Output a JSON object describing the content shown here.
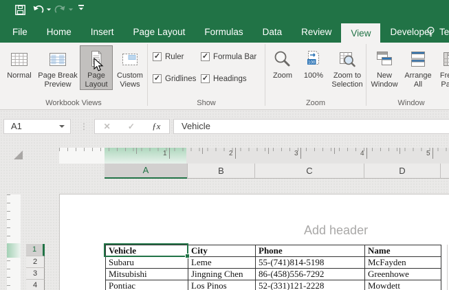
{
  "colors": {
    "brand_green": "#217346",
    "ribbon_bg": "#f3f2f1",
    "canvas_bg": "#e9e8e7",
    "selection_green": "#217346",
    "page_bg": "#ffffff",
    "header_placeholder_gray": "#a9a8a7"
  },
  "titlebar": {
    "qat_icons": [
      "save-icon",
      "undo-icon",
      "redo-icon",
      "customize-qat-icon"
    ]
  },
  "tabs": {
    "items": [
      {
        "label": "File",
        "active": false
      },
      {
        "label": "Home",
        "active": false
      },
      {
        "label": "Insert",
        "active": false
      },
      {
        "label": "Page Layout",
        "active": false
      },
      {
        "label": "Formulas",
        "active": false
      },
      {
        "label": "Data",
        "active": false
      },
      {
        "label": "Review",
        "active": false
      },
      {
        "label": "View",
        "active": true
      },
      {
        "label": "Developer",
        "active": false
      }
    ],
    "tell_me": {
      "icon": "lightbulb-icon",
      "label": "Tell me"
    }
  },
  "ribbon": {
    "groups": [
      {
        "name": "Workbook Views",
        "buttons": [
          {
            "label": "Normal",
            "icon": "normal-view-icon",
            "pressed": false
          },
          {
            "label": "Page Break Preview",
            "icon": "page-break-preview-icon",
            "pressed": false
          },
          {
            "label": "Page Layout",
            "icon": "page-layout-view-icon",
            "pressed": true
          },
          {
            "label": "Custom Views",
            "icon": "custom-views-icon",
            "pressed": false
          }
        ]
      },
      {
        "name": "Show",
        "checkboxes": [
          {
            "label": "Ruler",
            "checked": true
          },
          {
            "label": "Gridlines",
            "checked": true
          },
          {
            "label": "Formula Bar",
            "checked": true
          },
          {
            "label": "Headings",
            "checked": true
          }
        ]
      },
      {
        "name": "Zoom",
        "buttons": [
          {
            "label": "Zoom",
            "icon": "zoom-icon"
          },
          {
            "label": "100%",
            "icon": "zoom-100-icon"
          },
          {
            "label": "Zoom to Selection",
            "icon": "zoom-to-selection-icon"
          }
        ]
      },
      {
        "name": "Window",
        "buttons": [
          {
            "label": "New Window",
            "icon": "new-window-icon"
          },
          {
            "label": "Arrange All",
            "icon": "arrange-all-icon"
          },
          {
            "label": "Freeze Panes",
            "icon": "freeze-panes-icon"
          }
        ]
      }
    ]
  },
  "formula_bar": {
    "name_box": "A1",
    "icons": [
      "cancel-icon",
      "enter-icon",
      "insert-function-icon"
    ],
    "formula": "Vehicle"
  },
  "ruler": {
    "units": [
      "1",
      "2",
      "3",
      "4",
      "5"
    ]
  },
  "column_headers": [
    "A",
    "B",
    "C",
    "D"
  ],
  "row_headers": [
    "1",
    "2",
    "3",
    "4"
  ],
  "page": {
    "header_placeholder": "Add header"
  },
  "sheet_data": {
    "type": "table",
    "selected_cell": "A1",
    "headers": [
      "Vehicle",
      "City",
      "Phone",
      "Name"
    ],
    "rows": [
      [
        "Subaru",
        "Leme",
        "55-(741)814-5198",
        "McFayden"
      ],
      [
        "Mitsubishi",
        "Jingning Chen",
        "86-(458)556-7292",
        "Greenhowe"
      ],
      [
        "Pontiac",
        "Los Pinos",
        "52-(331)121-2228",
        "Mowdett"
      ]
    ]
  }
}
